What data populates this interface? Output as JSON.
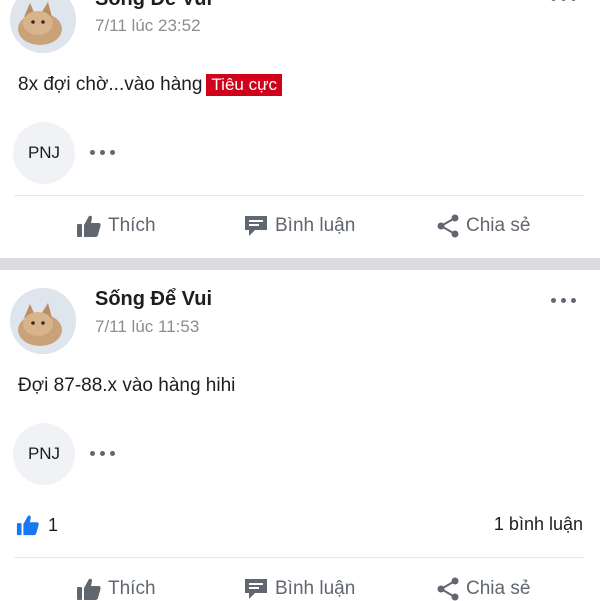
{
  "posts": [
    {
      "author": "Sống Để Vui",
      "time": "7/11 lúc 23:52",
      "text": "8x đợi chờ...vào hàng",
      "badge": "Tiêu cực",
      "commenter_initials": "PNJ"
    },
    {
      "author": "Sống Để Vui",
      "time": "7/11 lúc 11:53",
      "text": "Đợi 87-88.x vào hàng hihi",
      "commenter_initials": "PNJ",
      "like_count": "1",
      "comment_count": "1 bình luận"
    }
  ],
  "actions": {
    "like": "Thích",
    "comment": "Bình luận",
    "share": "Chia sẻ"
  },
  "colors": {
    "badge_bg": "#d0021b",
    "like_blue": "#1877f2",
    "muted": "#606770"
  },
  "icons": [
    "thumbs-up-icon",
    "comment-icon",
    "share-icon",
    "more-icon",
    "like-reaction-icon"
  ]
}
